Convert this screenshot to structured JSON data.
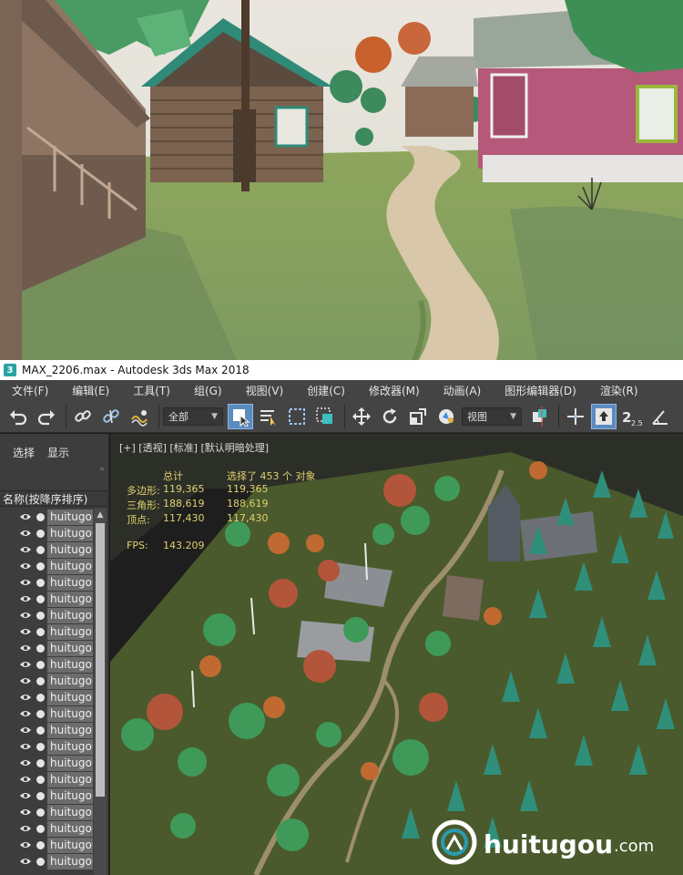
{
  "window": {
    "title": "MAX_2206.max - Autodesk 3ds Max 2018",
    "app_icon_glyph": "3"
  },
  "menubar": {
    "items": [
      "文件(F)",
      "编辑(E)",
      "工具(T)",
      "组(G)",
      "视图(V)",
      "创建(C)",
      "修改器(M)",
      "动画(A)",
      "图形编辑器(D)",
      "渲染(R)"
    ]
  },
  "toolbar": {
    "selection_filter": "全部",
    "reference_coord": "视图",
    "snap_label": "2.5",
    "icons": [
      "undo-icon",
      "redo-icon",
      "link-icon",
      "unlink-icon",
      "bind-spacewarp-icon",
      "select-object-icon",
      "select-by-name-icon",
      "rect-region-icon",
      "window-crossing-icon",
      "move-icon",
      "rotate-icon",
      "scale-icon",
      "pick-icon",
      "use-pivot-icon",
      "select-manipulate-icon",
      "snaps-icon",
      "angle-snap-icon"
    ]
  },
  "explorer": {
    "tab_select": "选择",
    "tab_display": "显示",
    "column_header": "名称(按降序排序)",
    "rows": [
      "huitugou",
      "huitugou",
      "huitugou",
      "huitugou",
      "huitugou",
      "huitugou",
      "huitugou",
      "huitugou",
      "huitugou",
      "huitugou",
      "huitugou",
      "huitugou",
      "huitugou",
      "huitugou",
      "huitugou",
      "huitugou",
      "huitugou",
      "huitugou",
      "huitugou",
      "huitugou",
      "huitugou",
      "huitugou"
    ]
  },
  "viewport": {
    "label": "[+] [透视] [标准] [默认明暗处理]",
    "stats": {
      "total_header": "总计",
      "selected_header": "选择了 453 个 对象",
      "rows": [
        {
          "label": "多边形:",
          "total": "119,365",
          "selected": "119,365"
        },
        {
          "label": "三角形:",
          "total": "188,619",
          "selected": "188,619"
        },
        {
          "label": "顶点:",
          "total": "117,430",
          "selected": "117,430"
        }
      ],
      "fps_label": "FPS:",
      "fps_value": "143.209"
    },
    "watermark_brand": "huitugou",
    "watermark_domain": ".com"
  },
  "colors": {
    "ui_dark": "#444444",
    "accent_active": "#5b8bbf",
    "stats_text": "#e0d070",
    "grass": "#46512a"
  }
}
